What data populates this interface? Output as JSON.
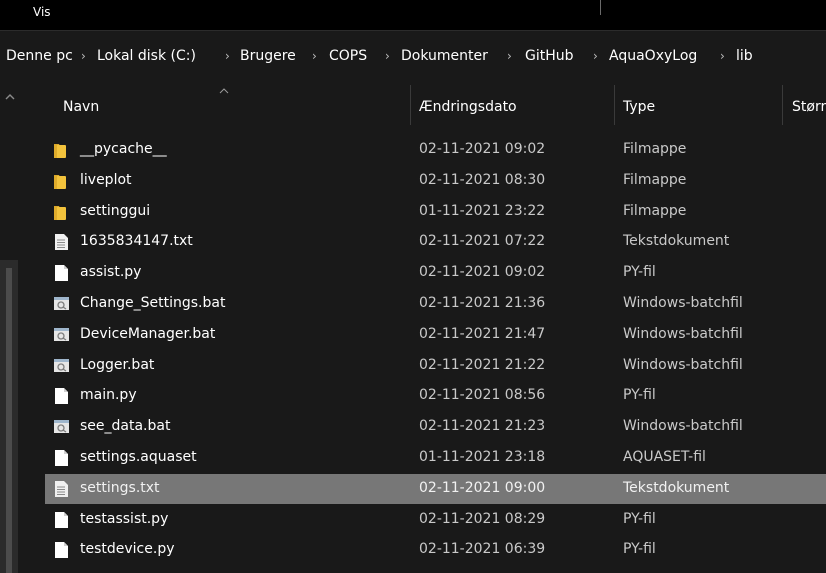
{
  "menu": {
    "view_label": "Vis"
  },
  "breadcrumb": [
    {
      "label": "Denne pc"
    },
    {
      "label": "Lokal disk (C:)"
    },
    {
      "label": "Brugere"
    },
    {
      "label": "COPS"
    },
    {
      "label": "Dokumenter"
    },
    {
      "label": "GitHub"
    },
    {
      "label": "AquaOxyLog"
    },
    {
      "label": "lib"
    }
  ],
  "columns": {
    "name": "Navn",
    "date": "Ændringsdato",
    "type": "Type",
    "size": "Størr"
  },
  "files": [
    {
      "name": "__pycache__",
      "date": "02-11-2021 09:02",
      "type": "Filmappe",
      "icon": "folder-icon"
    },
    {
      "name": "liveplot",
      "date": "02-11-2021 08:30",
      "type": "Filmappe",
      "icon": "folder-icon"
    },
    {
      "name": "settinggui",
      "date": "01-11-2021 23:22",
      "type": "Filmappe",
      "icon": "folder-icon"
    },
    {
      "name": "1635834147.txt",
      "date": "02-11-2021 07:22",
      "type": "Tekstdokument",
      "icon": "text-file-icon"
    },
    {
      "name": "assist.py",
      "date": "02-11-2021 09:02",
      "type": "PY-fil",
      "icon": "file-icon"
    },
    {
      "name": "Change_Settings.bat",
      "date": "02-11-2021 21:36",
      "type": "Windows-batchfil",
      "icon": "batch-file-icon"
    },
    {
      "name": "DeviceManager.bat",
      "date": "02-11-2021 21:47",
      "type": "Windows-batchfil",
      "icon": "batch-file-icon"
    },
    {
      "name": "Logger.bat",
      "date": "02-11-2021 21:22",
      "type": "Windows-batchfil",
      "icon": "batch-file-icon"
    },
    {
      "name": "main.py",
      "date": "02-11-2021 08:56",
      "type": "PY-fil",
      "icon": "file-icon"
    },
    {
      "name": "see_data.bat",
      "date": "02-11-2021 21:23",
      "type": "Windows-batchfil",
      "icon": "batch-file-icon"
    },
    {
      "name": "settings.aquaset",
      "date": "01-11-2021 23:18",
      "type": "AQUASET-fil",
      "icon": "file-icon"
    },
    {
      "name": "settings.txt",
      "date": "02-11-2021 09:00",
      "type": "Tekstdokument",
      "icon": "text-file-icon",
      "selected": true
    },
    {
      "name": "testassist.py",
      "date": "02-11-2021 08:29",
      "type": "PY-fil",
      "icon": "file-icon"
    },
    {
      "name": "testdevice.py",
      "date": "02-11-2021 06:39",
      "type": "PY-fil",
      "icon": "file-icon"
    }
  ],
  "colors": {
    "background": "#191919",
    "selection": "#777777",
    "folder": "#f3c33c"
  }
}
